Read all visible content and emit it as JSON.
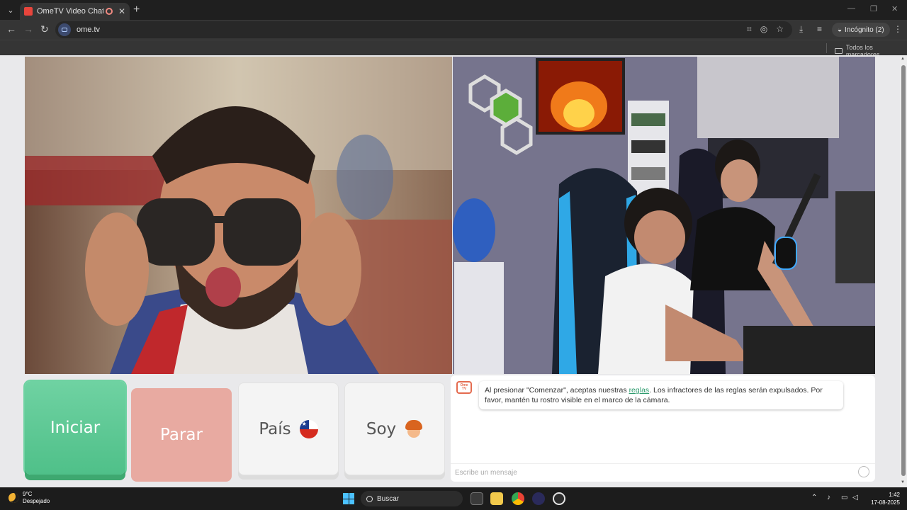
{
  "browser": {
    "tab_title": "OmeTV Video Chat — Ome",
    "url": "ome.tv",
    "incognito_label": "Incógnito (2)",
    "bookmarks_folder": "Todos los marcadores"
  },
  "controls": {
    "start_label": "Iniciar",
    "stop_label": "Parar",
    "country_label": "País",
    "gender_label": "Soy"
  },
  "chat": {
    "logo_text_top": "Ome",
    "logo_text_bottom": "TV",
    "message_before_link": "Al presionar \"Comenzar\", aceptas nuestras ",
    "message_link": "reglas",
    "message_after_link": ". Los infractores de las reglas serán expulsados. Por favor, mantén tu rostro visible en el marco de la cámara.",
    "input_placeholder": "Escribe un mensaje"
  },
  "taskbar": {
    "weather_temp": "9°C",
    "weather_desc": "Despejado",
    "search_label": "Buscar",
    "time": "1:42",
    "date": "17-08-2025"
  },
  "colors": {
    "start": "#5cc895",
    "stop": "#e8aaa1",
    "link": "#2e9b6e",
    "accent": "#e46b4f"
  },
  "icons": [
    "back-icon",
    "forward-icon",
    "reload-icon",
    "translate-icon",
    "eye-off-icon",
    "star-icon",
    "download-icon",
    "media-icon",
    "incognito-icon",
    "menu-icon",
    "folder-icon",
    "chile-flag-icon",
    "boy-emoji-icon",
    "emoji-icon",
    "windows-start-icon",
    "search-icon"
  ]
}
